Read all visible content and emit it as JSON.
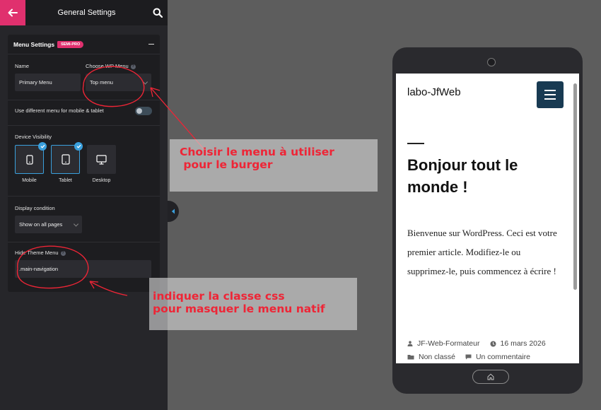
{
  "panel": {
    "title": "General Settings",
    "card_title": "Menu Settings",
    "badge": "SEMI-PRO",
    "name_label": "Name",
    "name_value": "Primary Menu",
    "wp_menu_label": "Choose WP Menu",
    "wp_menu_value": "Top menu",
    "mobile_menu_label": "Use different menu for mobile & tablet",
    "device_visibility_label": "Device Visibility",
    "devices": [
      {
        "label": "Mobile",
        "icon": "mobile-icon",
        "selected": true
      },
      {
        "label": "Tablet",
        "icon": "tablet-icon",
        "selected": true
      },
      {
        "label": "Desktop",
        "icon": "desktop-icon",
        "selected": false
      }
    ],
    "display_condition_label": "Display condition",
    "display_condition_value": "Show on all pages",
    "hide_theme_menu_label": "Hide Theme Menu",
    "hide_theme_menu_value": ".main-navigation"
  },
  "annotations": {
    "note1_line1": "Choisir le menu à utiliser",
    "note1_line2": " pour le burger",
    "note2_line1": "indiquer la classe css",
    "note2_line2": "pour masquer le menu natif",
    "color": "#ee2536"
  },
  "preview": {
    "site_title": "labo-JfWeb",
    "post_title": "Bonjour tout le monde !",
    "post_body": "Bienvenue sur WordPress. Ceci est votre premier article. Modifiez-le ou supprimez-le, puis commencez à écrire !",
    "author": "JF-Web-Formateur",
    "date": "16 mars 2026",
    "category": "Non classé",
    "comments": "Un commentaire"
  },
  "colors": {
    "accent": "#e0306e",
    "check": "#3aa0dd",
    "burger": "#183a52"
  }
}
